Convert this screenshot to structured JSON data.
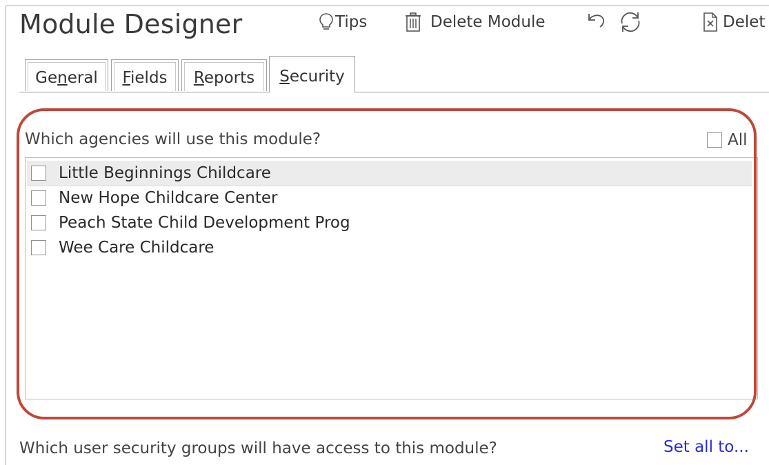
{
  "header": {
    "title": "Module Designer",
    "tips_label": "Tips",
    "delete_module_label": "Delete Module",
    "delete_partial_label": "Delet"
  },
  "tabs": [
    {
      "pre": "Ge",
      "u": "n",
      "post": "eral"
    },
    {
      "pre": "",
      "u": "F",
      "post": "ields"
    },
    {
      "pre": "",
      "u": "R",
      "post": "eports"
    },
    {
      "pre": "",
      "u": "S",
      "post": "ecurity"
    }
  ],
  "agencies": {
    "question": "Which agencies will use this module?",
    "all_label": "All",
    "items": [
      {
        "label": "Little Beginnings Childcare",
        "checked": false
      },
      {
        "label": "New Hope Childcare Center",
        "checked": false
      },
      {
        "label": "Peach State Child Development Prog",
        "checked": false
      },
      {
        "label": "Wee Care Childcare",
        "checked": false
      }
    ]
  },
  "security": {
    "question": "Which user security groups will have access to this module?",
    "set_all_label": "Set all to..."
  },
  "colors": {
    "annotation": "#c0473a",
    "link": "#2b2bd6"
  },
  "icons": {
    "tips": "lightbulb-icon",
    "delete_module": "trash-icon",
    "undo": "undo-icon",
    "refresh": "refresh-icon",
    "delete_doc": "document-x-icon"
  }
}
